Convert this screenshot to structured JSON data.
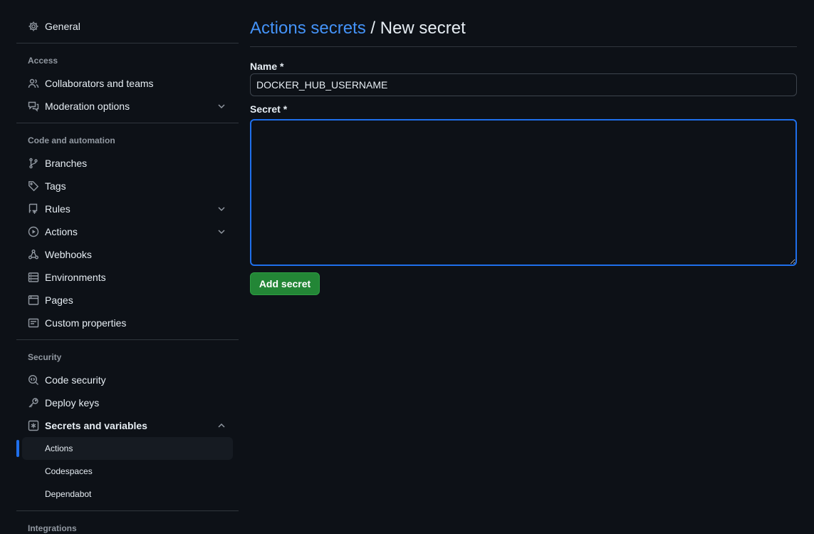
{
  "sidebar": {
    "general": {
      "label": "General",
      "icon": "gear-icon"
    },
    "access": {
      "title": "Access",
      "items": [
        {
          "label": "Collaborators and teams",
          "icon": "people-icon"
        },
        {
          "label": "Moderation options",
          "icon": "comment-discussion-icon",
          "expandable": true
        }
      ]
    },
    "code_automation": {
      "title": "Code and automation",
      "items": [
        {
          "label": "Branches",
          "icon": "git-branch-icon"
        },
        {
          "label": "Tags",
          "icon": "tag-icon"
        },
        {
          "label": "Rules",
          "icon": "repo-push-icon",
          "expandable": true
        },
        {
          "label": "Actions",
          "icon": "play-icon",
          "expandable": true
        },
        {
          "label": "Webhooks",
          "icon": "webhook-icon"
        },
        {
          "label": "Environments",
          "icon": "server-icon"
        },
        {
          "label": "Pages",
          "icon": "browser-icon"
        },
        {
          "label": "Custom properties",
          "icon": "note-icon"
        }
      ]
    },
    "security": {
      "title": "Security",
      "items": [
        {
          "label": "Code security",
          "icon": "codescan-icon"
        },
        {
          "label": "Deploy keys",
          "icon": "key-icon"
        },
        {
          "label": "Secrets and variables",
          "icon": "key-asterisk-icon",
          "expanded": true
        }
      ],
      "sub_items": [
        {
          "label": "Actions",
          "active": true
        },
        {
          "label": "Codespaces"
        },
        {
          "label": "Dependabot"
        }
      ]
    },
    "integrations": {
      "title": "Integrations"
    }
  },
  "main": {
    "breadcrumb_link": "Actions secrets",
    "breadcrumb_sep": " / ",
    "title": "New secret",
    "name_label": "Name *",
    "name_value": "DOCKER_HUB_USERNAME",
    "secret_label": "Secret *",
    "secret_value": "",
    "submit_label": "Add secret"
  },
  "colors": {
    "background": "#0d1117",
    "link": "#4493f8",
    "accent": "#1f6feb",
    "button": "#238636",
    "muted": "#9198a1",
    "border": "#30363d"
  }
}
